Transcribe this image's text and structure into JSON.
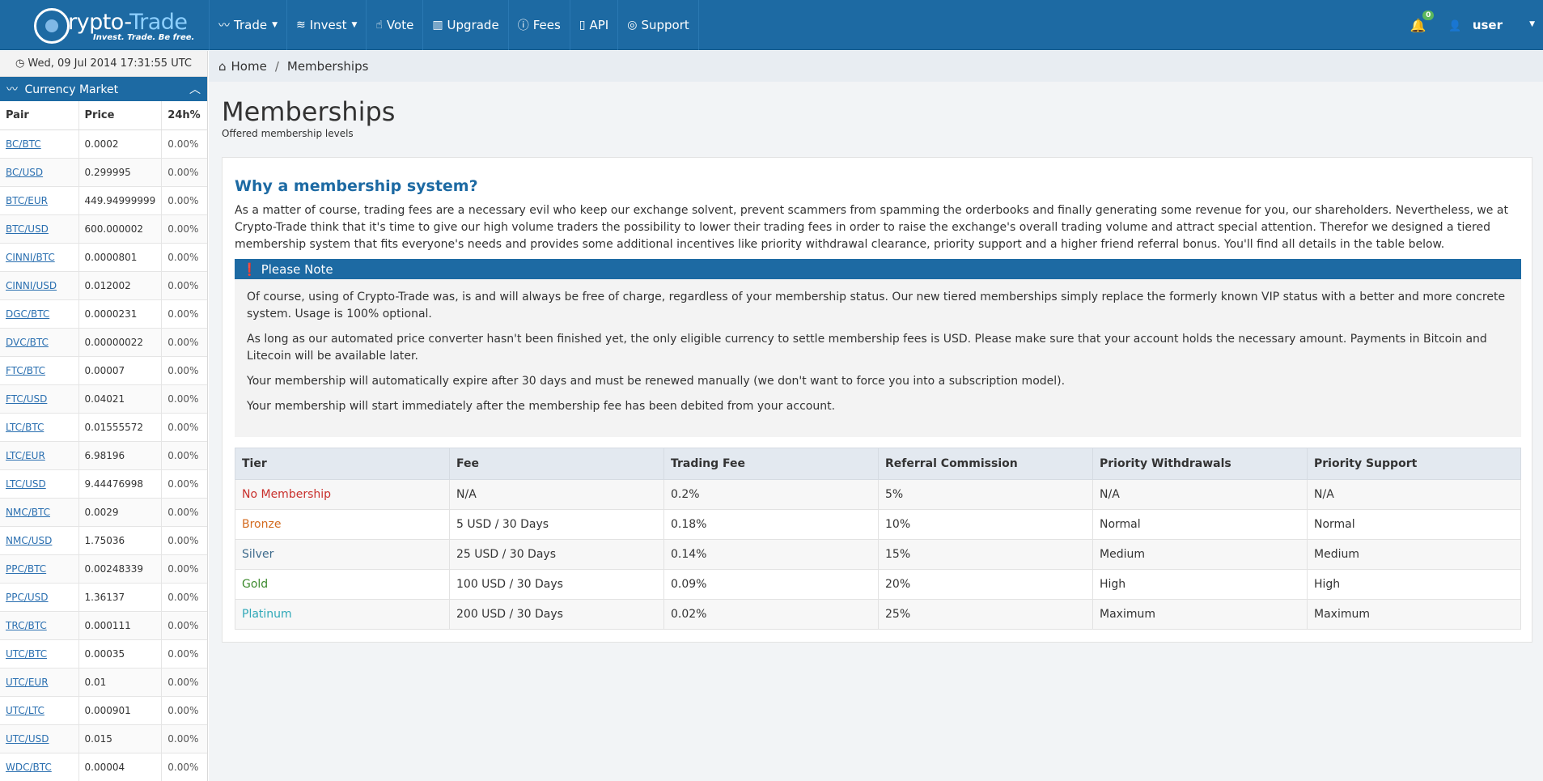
{
  "brand": {
    "name_part1": "rypto-",
    "name_part2": "Trade",
    "tagline": "Invest. Trade. Be free."
  },
  "nav": {
    "items": [
      {
        "label": "Trade",
        "icon": "chart-line-icon",
        "dropdown": true
      },
      {
        "label": "Invest",
        "icon": "layers-icon",
        "dropdown": true
      },
      {
        "label": "Vote",
        "icon": "thumbs-up-icon",
        "dropdown": false
      },
      {
        "label": "Upgrade",
        "icon": "bar-chart-icon",
        "dropdown": false
      },
      {
        "label": "Fees",
        "icon": "info-circle-icon",
        "dropdown": false
      },
      {
        "label": "API",
        "icon": "book-icon",
        "dropdown": false
      },
      {
        "label": "Support",
        "icon": "lifebuoy-icon",
        "dropdown": false
      }
    ],
    "notification_count": "0",
    "user_label": "user"
  },
  "sidebar": {
    "clock": "Wed, 09 Jul 2014 17:31:55 UTC",
    "market_title": "Currency Market",
    "headers": [
      "Pair",
      "Price",
      "24h%"
    ],
    "rows": [
      {
        "pair": "BC/BTC",
        "price": "0.0002",
        "change": "0.00%"
      },
      {
        "pair": "BC/USD",
        "price": "0.299995",
        "change": "0.00%"
      },
      {
        "pair": "BTC/EUR",
        "price": "449.94999999",
        "change": "0.00%"
      },
      {
        "pair": "BTC/USD",
        "price": "600.000002",
        "change": "0.00%"
      },
      {
        "pair": "CINNI/BTC",
        "price": "0.0000801",
        "change": "0.00%"
      },
      {
        "pair": "CINNI/USD",
        "price": "0.012002",
        "change": "0.00%"
      },
      {
        "pair": "DGC/BTC",
        "price": "0.0000231",
        "change": "0.00%"
      },
      {
        "pair": "DVC/BTC",
        "price": "0.00000022",
        "change": "0.00%"
      },
      {
        "pair": "FTC/BTC",
        "price": "0.00007",
        "change": "0.00%"
      },
      {
        "pair": "FTC/USD",
        "price": "0.04021",
        "change": "0.00%"
      },
      {
        "pair": "LTC/BTC",
        "price": "0.01555572",
        "change": "0.00%"
      },
      {
        "pair": "LTC/EUR",
        "price": "6.98196",
        "change": "0.00%"
      },
      {
        "pair": "LTC/USD",
        "price": "9.44476998",
        "change": "0.00%"
      },
      {
        "pair": "NMC/BTC",
        "price": "0.0029",
        "change": "0.00%"
      },
      {
        "pair": "NMC/USD",
        "price": "1.75036",
        "change": "0.00%"
      },
      {
        "pair": "PPC/BTC",
        "price": "0.00248339",
        "change": "0.00%"
      },
      {
        "pair": "PPC/USD",
        "price": "1.36137",
        "change": "0.00%"
      },
      {
        "pair": "TRC/BTC",
        "price": "0.000111",
        "change": "0.00%"
      },
      {
        "pair": "UTC/BTC",
        "price": "0.00035",
        "change": "0.00%"
      },
      {
        "pair": "UTC/EUR",
        "price": "0.01",
        "change": "0.00%"
      },
      {
        "pair": "UTC/LTC",
        "price": "0.000901",
        "change": "0.00%"
      },
      {
        "pair": "UTC/USD",
        "price": "0.015",
        "change": "0.00%"
      },
      {
        "pair": "WDC/BTC",
        "price": "0.00004",
        "change": "0.00%"
      }
    ]
  },
  "breadcrumb": {
    "home": "Home",
    "separator": "/",
    "current": "Memberships"
  },
  "page": {
    "title": "Memberships",
    "subtitle": "Offered membership levels",
    "why_title": "Why a membership system?",
    "why_text": "As a matter of course, trading fees are a necessary evil who keep our exchange solvent, prevent scammers from spamming the orderbooks and finally generating some revenue for you, our shareholders. Nevertheless, we at Crypto-Trade think that it's time to give our high volume traders the possibility to lower their trading fees in order to raise the exchange's overall trading volume and attract special attention. Therefor we designed a tiered membership system that fits everyone's needs and provides some additional incentives like priority withdrawal clearance, priority support and a higher friend referral bonus. You'll find all details in the table below.",
    "note_title": "Please Note",
    "notes": [
      "Of course, using of Crypto-Trade was, is and will always be free of charge, regardless of your membership status. Our new tiered memberships simply replace the formerly known VIP status with a better and more concrete system. Usage is 100% optional.",
      "As long as our automated price converter hasn't been finished yet, the only eligible currency to settle membership fees is USD. Please make sure that your account holds the necessary amount. Payments in Bitcoin and Litecoin will be available later.",
      "Your membership will automatically expire after 30 days and must be renewed manually (we don't want to force you into a subscription model).",
      "Your membership will start immediately after the membership fee has been debited from your account."
    ]
  },
  "tiers": {
    "headers": [
      "Tier",
      "Fee",
      "Trading Fee",
      "Referral Commission",
      "Priority Withdrawals",
      "Priority Support"
    ],
    "rows": [
      {
        "tier": "No Membership",
        "fee": "N/A",
        "trading_fee": "0.2%",
        "referral": "5%",
        "withdrawals": "N/A",
        "support": "N/A",
        "color": "#c9302c"
      },
      {
        "tier": "Bronze",
        "fee": "5 USD / 30 Days",
        "trading_fee": "0.18%",
        "referral": "10%",
        "withdrawals": "Normal",
        "support": "Normal",
        "color": "#d36a1e"
      },
      {
        "tier": "Silver",
        "fee": "25 USD / 30 Days",
        "trading_fee": "0.14%",
        "referral": "15%",
        "withdrawals": "Medium",
        "support": "Medium",
        "color": "#3e6b8c"
      },
      {
        "tier": "Gold",
        "fee": "100 USD / 30 Days",
        "trading_fee": "0.09%",
        "referral": "20%",
        "withdrawals": "High",
        "support": "High",
        "color": "#3d8a2e"
      },
      {
        "tier": "Platinum",
        "fee": "200 USD / 30 Days",
        "trading_fee": "0.02%",
        "referral": "25%",
        "withdrawals": "Maximum",
        "support": "Maximum",
        "color": "#2fa8b8"
      }
    ]
  },
  "colors": {
    "brand_blue": "#1d6aa3",
    "breadcrumb_bg": "#e8edf2",
    "notification_badge": "#5cb85c"
  }
}
